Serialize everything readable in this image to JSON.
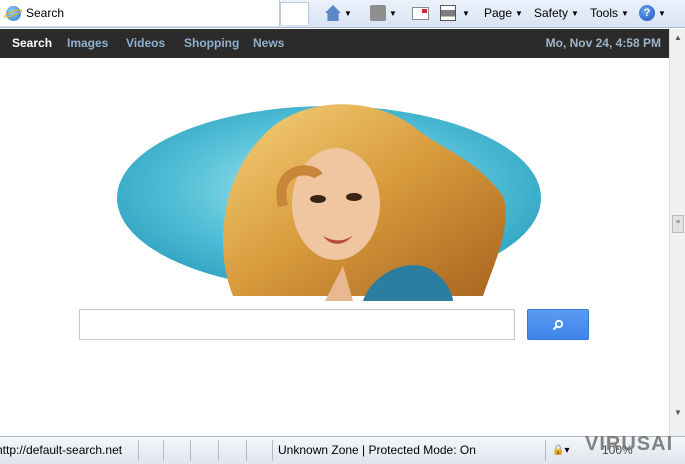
{
  "browser": {
    "tab_title": "Search",
    "commands": {
      "page": "Page",
      "safety": "Safety",
      "tools": "Tools"
    },
    "icons": [
      "home-icon",
      "feeds-icon",
      "read-mail-icon",
      "print-icon",
      "help-icon"
    ]
  },
  "nav": {
    "items": [
      {
        "label": "Search",
        "active": true
      },
      {
        "label": "Images",
        "active": false
      },
      {
        "label": "Videos",
        "active": false
      },
      {
        "label": "Shopping",
        "active": false
      },
      {
        "label": "News",
        "active": false
      }
    ],
    "datetime": "Mo, Nov 24, 4:58 PM"
  },
  "search": {
    "value": "",
    "placeholder": ""
  },
  "status_bar": {
    "url": "http://default-search.net",
    "zone": "Unknown Zone | Protected Mode: On",
    "zoom": "100%"
  },
  "watermark": "VIRUSAI",
  "colors": {
    "nav_bg": "#2b2b2b",
    "nav_link": "#8fb1d0",
    "search_button": "#4a8ff0",
    "hero_blue": "#3fb3cf"
  }
}
